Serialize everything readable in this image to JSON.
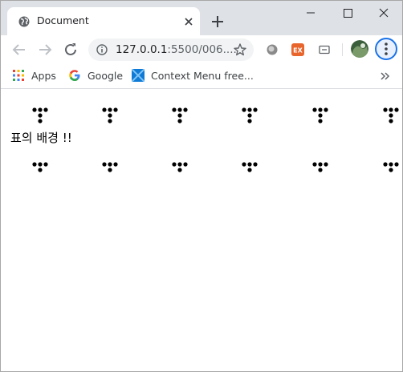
{
  "browser": {
    "tab": {
      "title": "Document",
      "favicon": "globe-icon"
    },
    "new_tab_icon": "plus-icon",
    "window_controls": [
      "minimize-icon",
      "maximize-icon",
      "close-icon"
    ],
    "address": {
      "host": "127.0.0.1",
      "rest": ":5500/006...."
    },
    "bookmarks": [
      {
        "label": "Apps",
        "icon": "apps-grid-icon"
      },
      {
        "label": "Google",
        "icon": "google-icon"
      },
      {
        "label": "Context Menu free...",
        "icon": "context-menu-icon"
      }
    ],
    "accent_color": "#1a73e8"
  },
  "page": {
    "text": "표의 배경 !!",
    "pattern_rows": [
      {
        "glyph": "dots-down-icon",
        "count": 6
      },
      {
        "glyph": "dots-down-icon",
        "count": 6
      }
    ]
  }
}
